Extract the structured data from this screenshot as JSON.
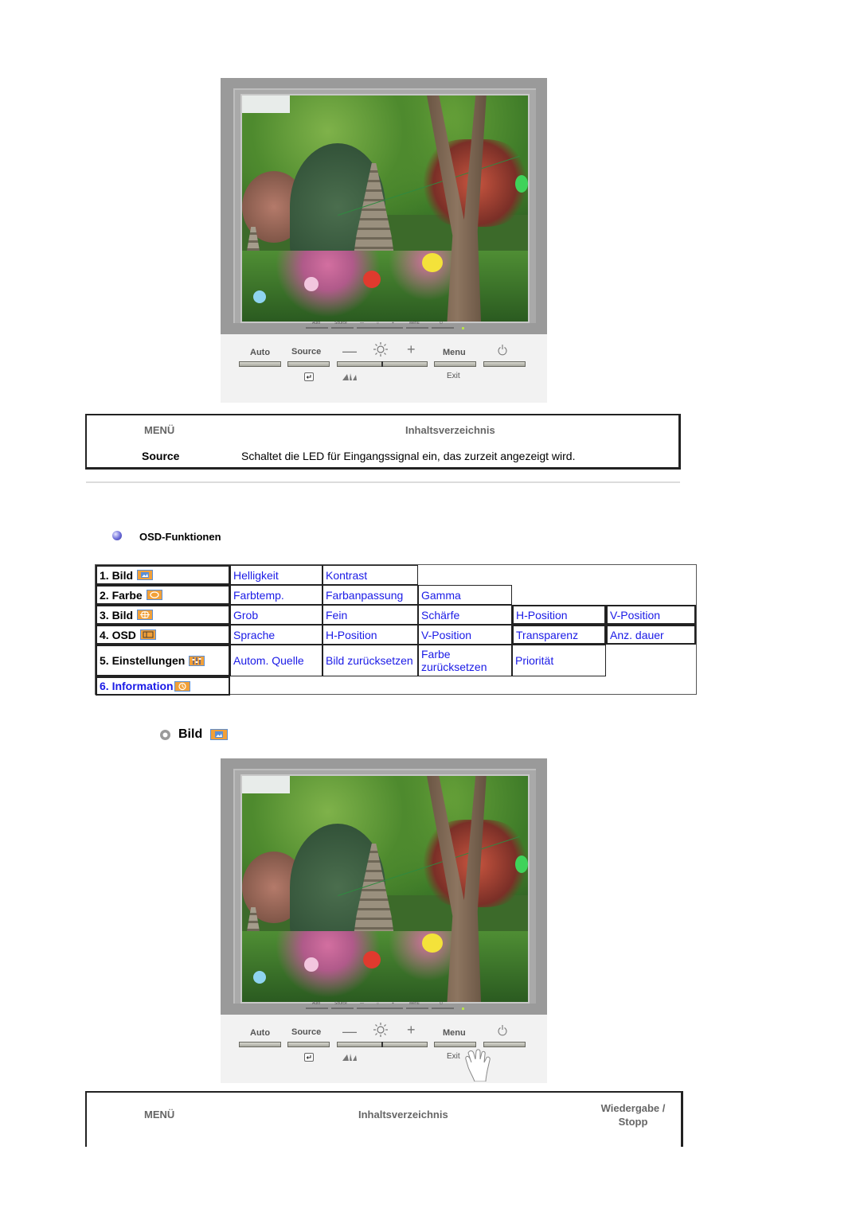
{
  "monitor": {
    "mini_labels": [
      "Auto",
      "Source",
      "—",
      "☼",
      "+",
      "Menu",
      "⏻"
    ],
    "mini_sub_labels": [
      "Exit"
    ],
    "buttons": {
      "auto": "Auto",
      "source": "Source",
      "minus": "—",
      "plus": "+",
      "menu": "Menu",
      "exit": "Exit"
    },
    "icons": [
      "brightness-icon",
      "power-icon",
      "enter-icon",
      "magic-bright-icon",
      "hand-pointer-icon"
    ]
  },
  "source_table": {
    "col_menu": "MENÜ",
    "col_contents": "Inhaltsverzeichnis",
    "row_label": "Source",
    "row_text": "Schaltet die LED für Eingangssignal ein, das zurzeit angezeigt wird."
  },
  "osd_section": {
    "title": "OSD-Funktionen",
    "rows": [
      {
        "label": "1. Bild",
        "icon": "picture-icon",
        "items": [
          "Helligkeit",
          "Kontrast"
        ]
      },
      {
        "label": "2. Farbe",
        "icon": "color-icon",
        "items": [
          "Farbtemp.",
          "Farbanpassung",
          "Gamma"
        ]
      },
      {
        "label": "3. Bild",
        "icon": "image-adjust-icon",
        "items": [
          "Grob",
          "Fein",
          "Schärfe",
          "H-Position",
          "V-Position"
        ]
      },
      {
        "label": "4. OSD",
        "icon": "osd-icon",
        "items": [
          "Sprache",
          "H-Position",
          "V-Position",
          "Transparenz",
          "Anz. dauer"
        ]
      },
      {
        "label": "5. Einstellungen",
        "icon": "setup-icon",
        "items": [
          "Autom. Quelle",
          "Bild zurücksetzen",
          "Farbe zurücksetzen",
          "Priorität"
        ]
      },
      {
        "label": "6. Information",
        "icon": "information-icon",
        "items": []
      }
    ]
  },
  "bild_section": {
    "title": "Bild"
  },
  "bottom_table": {
    "col_menu": "MENÜ",
    "col_contents": "Inhaltsverzeichnis",
    "col_play": "Wiedergabe / Stopp"
  }
}
